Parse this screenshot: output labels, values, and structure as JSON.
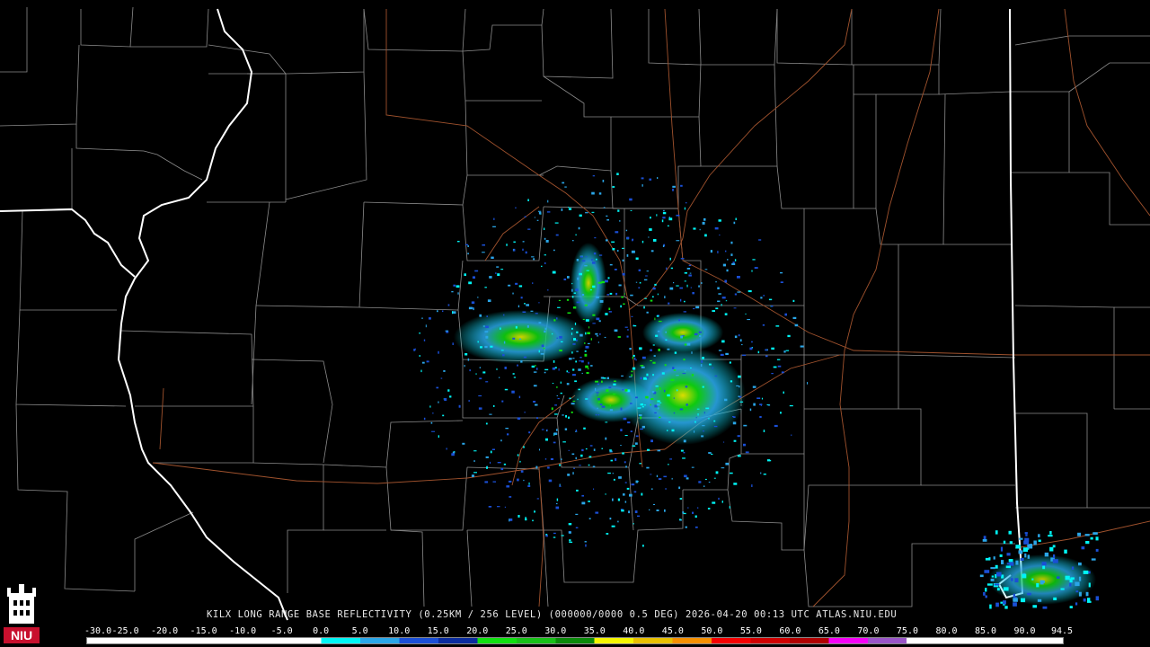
{
  "header": {
    "product_text": "KILX LONG RANGE BASE REFLECTIVITY (0.25KM / 256 LEVEL) (000000/0000 0.5 DEG) 2026-04-20 00:13 UTC  ATLAS.NIU.EDU"
  },
  "legend": {
    "scale_labels": [
      "-30.0",
      "-25.0",
      "-20.0",
      "-15.0",
      "-10.0",
      "-5.0",
      "0.0",
      "5.0",
      "10.0",
      "15.0",
      "20.0",
      "25.0",
      "30.0",
      "35.0",
      "40.0",
      "45.0",
      "50.0",
      "55.0",
      "60.0",
      "65.0",
      "70.0",
      "75.0",
      "80.0",
      "85.0",
      "90.0",
      "94.5"
    ],
    "colors": {
      "neg": "#ffffff",
      "0": "#00f5f5",
      "5": "#2aa6e8",
      "10": "#1a4fd6",
      "15": "#0a2c9e",
      "20": "#10e010",
      "25": "#18c018",
      "30": "#0a8a0a",
      "35": "#f5f500",
      "40": "#e8c000",
      "45": "#f59000",
      "50": "#f50000",
      "55": "#d00000",
      "60": "#b00000",
      "65": "#f500f5",
      "70": "#9a55c8",
      "75": "#ffffff",
      "80": "#ffffff"
    }
  },
  "logo": {
    "text": "NIU",
    "icon": "university-tower-icon"
  },
  "map": {
    "radar_site": "KILX",
    "colors": {
      "background": "#000000",
      "county_lines": "#8c8c8c",
      "state_lines": "#ffffff",
      "highways": "#a0522d"
    }
  }
}
